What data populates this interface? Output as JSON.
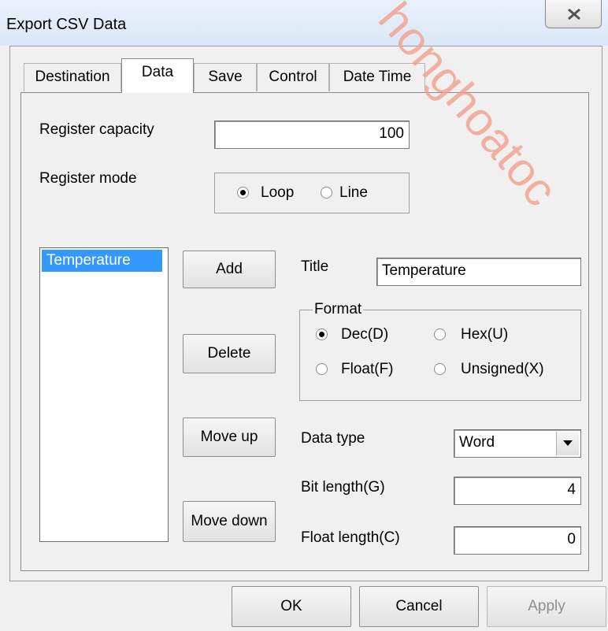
{
  "window": {
    "title": "Export CSV Data",
    "watermark": "honghoatoc"
  },
  "tabs": [
    {
      "label": "Destination",
      "active": false
    },
    {
      "label": "Data",
      "active": true
    },
    {
      "label": "Save",
      "active": false
    },
    {
      "label": "Control",
      "active": false
    },
    {
      "label": "Date Time",
      "active": false
    }
  ],
  "register": {
    "capacity_label": "Register capacity",
    "capacity_value": "100",
    "mode_label": "Register mode",
    "mode_options": [
      "Loop",
      "Line"
    ],
    "mode_selected": "Loop"
  },
  "list": {
    "items": [
      "Temperature"
    ],
    "selected": "Temperature"
  },
  "buttons": {
    "add": "Add",
    "delete": "Delete",
    "move_up": "Move up",
    "move_down": "Move down"
  },
  "title_field": {
    "label": "Title",
    "value": "Temperature"
  },
  "format": {
    "group_label": "Format",
    "options": [
      "Dec(D)",
      "Hex(U)",
      "Float(F)",
      "Unsigned(X)"
    ],
    "selected": "Dec(D)"
  },
  "data_type": {
    "label": "Data type",
    "value": "Word"
  },
  "bit_length": {
    "label": "Bit length(G)",
    "value": "4"
  },
  "float_length": {
    "label": "Float length(C)",
    "value": "0"
  },
  "footer": {
    "ok": "OK",
    "cancel": "Cancel",
    "apply": "Apply",
    "apply_enabled": false
  },
  "colors": {
    "selection": "#3399ff",
    "watermark": "#f2a08c",
    "dialog_bg": "#f0f0f0"
  },
  "icons": {
    "close": "close-icon",
    "dropdown": "chevron-down-icon"
  }
}
